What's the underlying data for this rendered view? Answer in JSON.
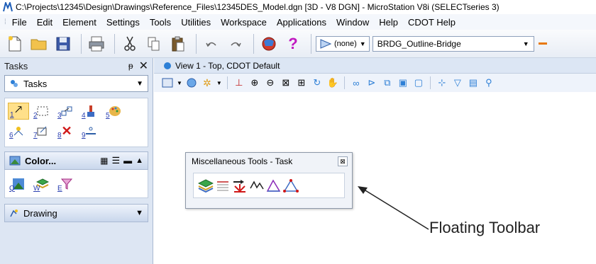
{
  "window": {
    "title": "C:\\Projects\\12345\\Design\\Drawings\\Reference_Files\\12345DES_Model.dgn [3D - V8 DGN] - MicroStation V8i (SELECTseries 3)"
  },
  "menu": {
    "items": [
      "File",
      "Edit",
      "Element",
      "Settings",
      "Tools",
      "Utilities",
      "Workspace",
      "Applications",
      "Window",
      "Help",
      "CDOT Help"
    ]
  },
  "toolbar": {
    "level_none": "(none)",
    "level_name": "BRDG_Outline-Bridge"
  },
  "tasks_panel": {
    "header": "Tasks",
    "dropdown_value": "Tasks",
    "tool_numbers": [
      "1",
      "2",
      "3",
      "4",
      "5",
      "6",
      "7",
      "8",
      "9"
    ],
    "color_section": "Color...",
    "color_tool_numbers": [
      "Q",
      "W",
      "E"
    ],
    "drawing_section": "Drawing"
  },
  "view": {
    "tab_label": "View 1 - Top, CDOT Default"
  },
  "floating_toolbar": {
    "title": "Miscellaneous Tools - Task"
  },
  "annotation": {
    "label": "Floating Toolbar"
  },
  "colors": {
    "accent_blue": "#2d7fd6",
    "panel_bg": "#dde6f3",
    "orange": "#e8780c"
  }
}
